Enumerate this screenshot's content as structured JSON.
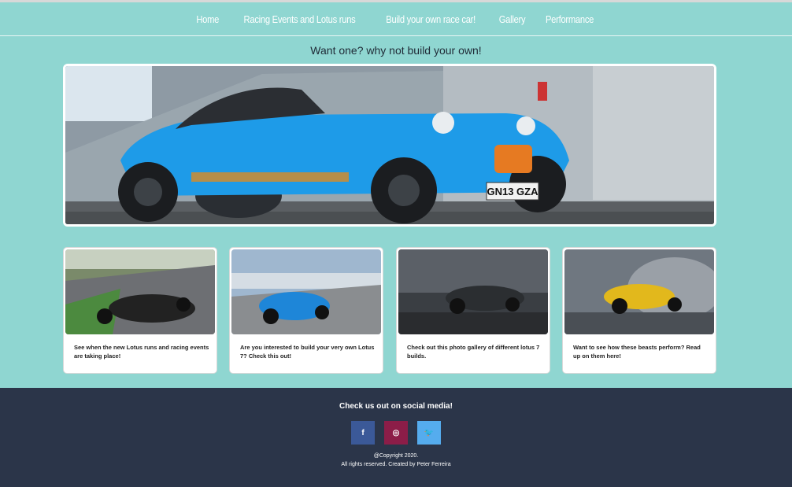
{
  "nav": {
    "items": [
      {
        "label": "Home"
      },
      {
        "label": "Racing Events and Lotus runs"
      },
      {
        "label": "Build your own race car!"
      },
      {
        "label": "Gallery"
      },
      {
        "label": "Performance"
      }
    ]
  },
  "tagline": "Want one? why not build your own!",
  "hero": {
    "plate": "GN13 GZA"
  },
  "cards": [
    {
      "caption": "See when the new Lotus runs and racing events are taking place!"
    },
    {
      "caption": "Are you interested to build your very own Lotus 7? Check this out!"
    },
    {
      "caption": "Check out this photo gallery of different lotus 7 builds."
    },
    {
      "caption": "Want to see how these beasts perform? Read up on them here!"
    }
  ],
  "footer": {
    "social_title": "Check us out on social media!",
    "copyright_line1": "@Copyright 2020.",
    "copyright_line2": "All rights reserved. Created by Peter Ferreira",
    "icons": {
      "facebook": "f",
      "instagram": "◎",
      "twitter": "🐦"
    }
  },
  "colors": {
    "background": "#8fd6d1",
    "footer": "#2b3549",
    "facebook": "#3b5998",
    "instagram": "#8c1d48",
    "twitter": "#55acee"
  }
}
